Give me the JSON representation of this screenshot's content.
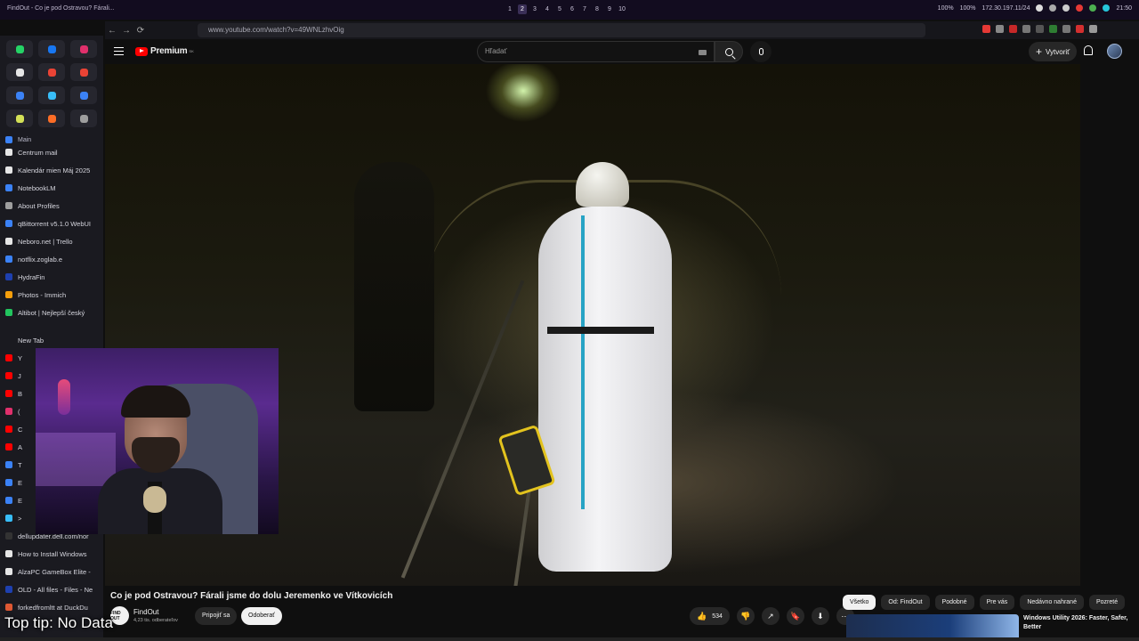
{
  "os": {
    "window_title": "FindOut - Co je pod Ostravou? Fárali...",
    "workspaces": [
      "1",
      "2",
      "3",
      "4",
      "5",
      "6",
      "7",
      "8",
      "9",
      "10"
    ],
    "active_workspace": 1,
    "volume": "100%",
    "battery": "100%",
    "ip": "172.30.197.11/24",
    "clock": "21:50"
  },
  "browser": {
    "url": "www.youtube.com/watch?v=49WNLzhvOig",
    "back_icon": "←",
    "forward_icon": "→",
    "reload_icon": "⟳"
  },
  "sidebar": {
    "pins": [
      {
        "icon": "whatsapp-icon",
        "color": "#25d366"
      },
      {
        "icon": "messenger-icon",
        "color": "#1877f2"
      },
      {
        "icon": "instagram-icon",
        "color": "#e1306c"
      },
      {
        "icon": "x-icon",
        "color": "#e6e6e6"
      },
      {
        "icon": "gmail-icon",
        "color": "#ea4335"
      },
      {
        "icon": "gmail-icon",
        "color": "#ea4335"
      },
      {
        "icon": "chat-icon",
        "color": "#3b82f6"
      },
      {
        "icon": "drive-icon",
        "color": "#38bdf8"
      },
      {
        "icon": "app-icon",
        "color": "#3b82f6"
      },
      {
        "icon": "app-icon",
        "color": "#d4e157"
      },
      {
        "icon": "gitlab-icon",
        "color": "#fc6d26"
      },
      {
        "icon": "app-icon",
        "color": "#9e9e9e"
      }
    ],
    "section_main": "Main",
    "items": [
      {
        "label": "Centrum mail",
        "color": "#e6e6e6"
      },
      {
        "label": "Kalendár mien Máj 2025",
        "color": "#e6e6e6"
      },
      {
        "label": "NotebookLM",
        "color": "#3b82f6"
      },
      {
        "label": "About Profiles",
        "color": "#9e9e9e"
      },
      {
        "label": "qBittorrent v5.1.0 WebUI",
        "color": "#3b82f6"
      },
      {
        "label": "Neboro.net | Trello",
        "color": "#e6e6e6"
      },
      {
        "label": "notflix.zoglab.e",
        "color": "#3b82f6"
      },
      {
        "label": "HydraFin",
        "color": "#1e40af"
      },
      {
        "label": "Photos - Immich",
        "color": "#f59e0b"
      },
      {
        "label": "Altibot | Nejlepší český",
        "color": "#22c55e"
      }
    ],
    "new_tab": "New Tab",
    "tabs_partial": [
      {
        "label": "Y",
        "color": "#ff0000"
      },
      {
        "label": "J",
        "color": "#ff0000"
      },
      {
        "label": "B",
        "color": "#ff0000"
      },
      {
        "label": "(",
        "color": "#e1306c"
      },
      {
        "label": "C",
        "color": "#ff0000"
      },
      {
        "label": "A",
        "color": "#ff0000"
      },
      {
        "label": "T",
        "color": "#3b82f6"
      },
      {
        "label": "E",
        "color": "#3b82f6"
      },
      {
        "label": "E",
        "color": "#3b82f6"
      },
      {
        "label": ">",
        "color": "#38bdf8"
      }
    ],
    "items_bottom": [
      {
        "label": "dellupdater.dell.com/nor",
        "color": "#333333"
      },
      {
        "label": "How to Install Windows",
        "color": "#e6e6e6"
      },
      {
        "label": "AlzaPC GameBox Elite -",
        "color": "#e6e6e6"
      },
      {
        "label": "OLD - All files - Files - Ne",
        "color": "#1e40af"
      },
      {
        "label": "forkedfromltt at DuckDu",
        "color": "#de5833"
      }
    ]
  },
  "youtube": {
    "brand": "Premium",
    "brand_sup": "SK",
    "search_placeholder": "Hľadať",
    "create_label": "Vytvoriť",
    "create_icon": "+"
  },
  "video": {
    "title": "Co je pod Ostravou? Fárali jsme do dolu Jeremenko ve Vítkovicích",
    "channel": "FindOut",
    "channel_avatar_text": "FIND OUT",
    "subscribers": "4,23 tis. odberateľov",
    "join_label": "Pripojiť sa",
    "subscribe_label": "Odoberať",
    "likes": "534",
    "like_icon": "👍",
    "dislike_icon": "👎",
    "share_icon": "↗",
    "save_icon": "🔖",
    "download_icon": "⬇",
    "more_icon": "⋯"
  },
  "chips": [
    {
      "label": "Všetko",
      "active": true
    },
    {
      "label": "Od: FindOut",
      "active": false
    },
    {
      "label": "Podobné",
      "active": false
    },
    {
      "label": "Pre vás",
      "active": false
    },
    {
      "label": "Nedávno nahrané",
      "active": false
    },
    {
      "label": "Pozreté",
      "active": false
    }
  ],
  "recommendation": {
    "title": "Windows Utility 2026: Faster, Safer, Better"
  },
  "overlay": {
    "tip": "Top tip: No Data"
  }
}
